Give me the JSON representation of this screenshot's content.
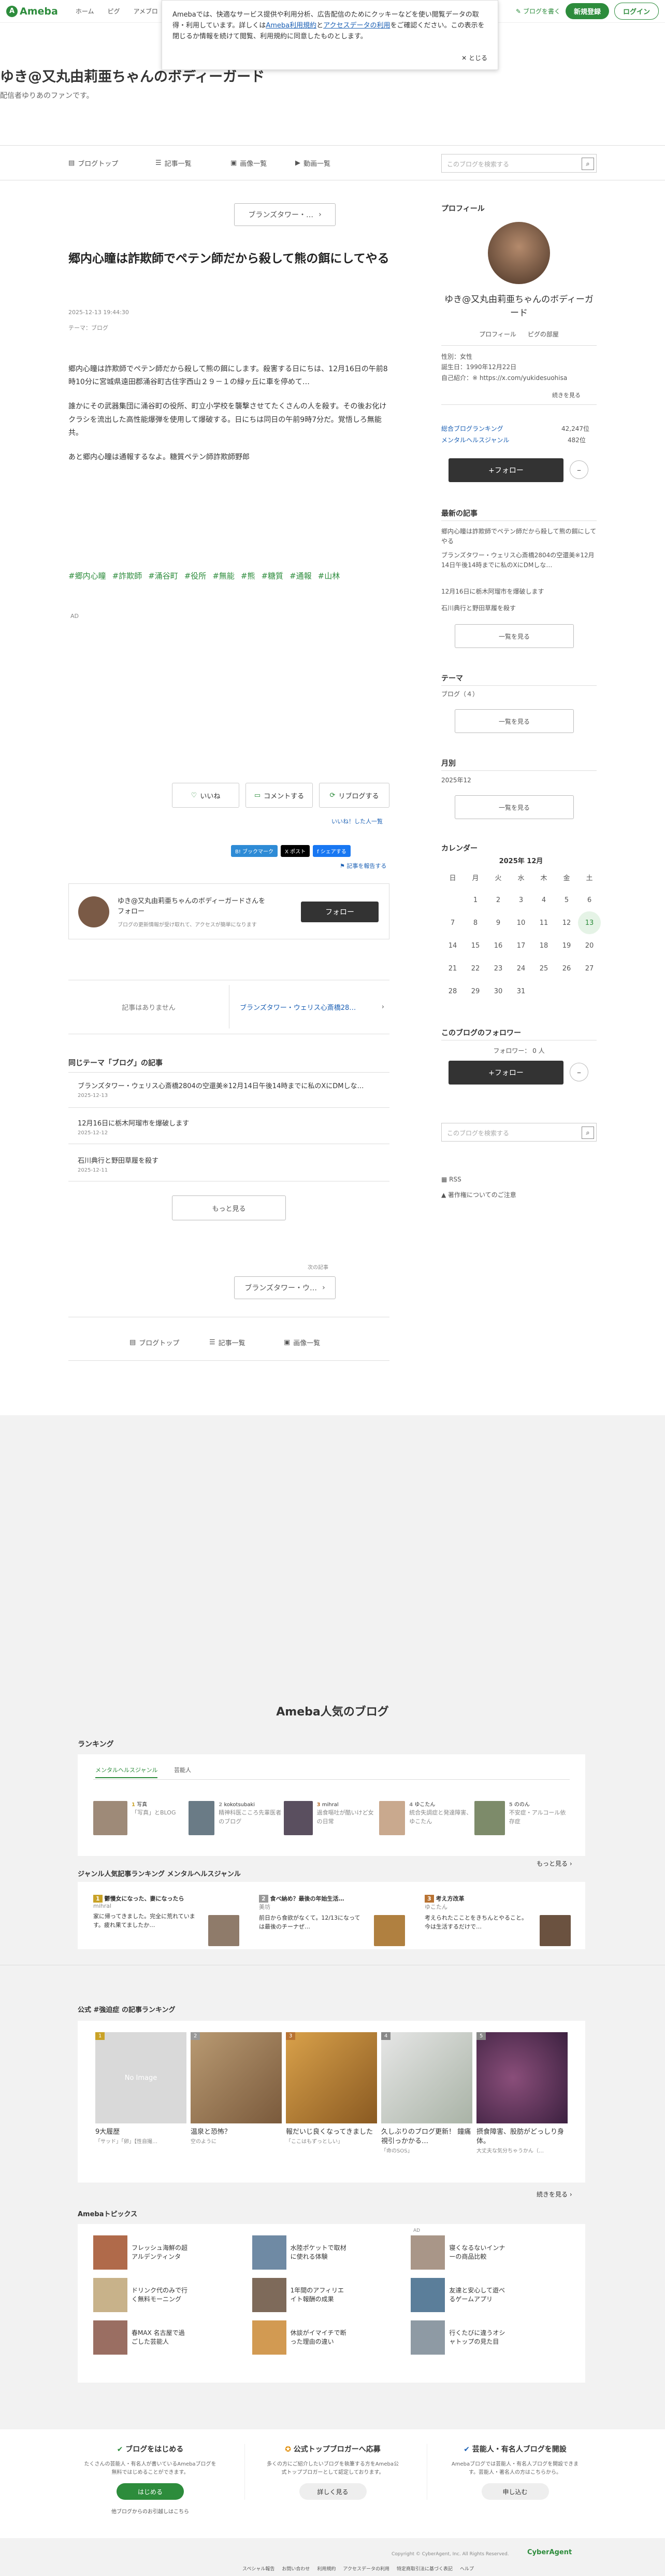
{
  "header": {
    "logo": "Ameba",
    "nav": [
      "ホーム",
      "ピグ",
      "アメブロ"
    ],
    "login_label": "ログイン",
    "register_label": "新規登録",
    "write_label": "ブログを書く"
  },
  "cookie": {
    "text1": "Amebaでは、快適なサービス提供や利用分析、広告配信のためにクッキーなどを使い閲覧データの取得・利用しています。詳しくは",
    "link1": "Ameba利用規約",
    "and": "と",
    "link2": "アクセスデータの利用",
    "text2": "をご確認ください。この表示を閉じるか情報を続けて閲覧、利用規約に同意したものとします。",
    "close": "とじる"
  },
  "blog": {
    "title": "ゆき@又丸由莉亜ちゃんのボディーガード",
    "subtitle": "配信者ゆりあのファンです。"
  },
  "blognav": {
    "items": [
      "ブログトップ",
      "記事一覧",
      "画像一覧",
      "動画一覧"
    ],
    "search_placeholder": "このブログを検索する"
  },
  "article": {
    "breadcrumb": "ブランズタワー・…",
    "title": "郷内心瞳は詐欺師でペテン師だから殺して熊の餌にしてやる",
    "date": "2025-12-13 19:44:30",
    "theme": "テーマ：ブログ",
    "body": [
      "郷内心瞳は詐欺師でペテン師だから殺して熊の餌にします。殺害する日にちは、12月16日の午前8時10分に宮城県遠田郡涌谷町古住字西山２９－１の緑ヶ丘に車を停めて…",
      "誰かにその武器集団に涌谷町の役所、町立小学校を襲撃させてたくさんの人を殺す。その後お化けクラシを流出した高性能爆弾を使用して爆破する。日にちは同日の午前9時7分だ。覚悟しろ無能共。",
      "あと郷内心瞳は通報するなよ。糖質ペテン師詐欺師野郎"
    ],
    "tags": [
      "#郷内心瞳",
      "#詐欺師",
      "#涌谷町",
      "#役所",
      "#無能",
      "#熊",
      "#糖質",
      "#通報",
      "#山林"
    ],
    "ad": "AD",
    "like": "いいね",
    "comment": "コメントする",
    "reblog": "リブログする",
    "like_list": "いいね！した人一覧",
    "share": [
      "B! ブックマーク",
      "X ポスト",
      "f シェアする"
    ],
    "report": "記事を報告する",
    "follow_text": "ゆき@又丸由莉亜ちゃんのボディーガードさんをフォロー",
    "follow_sub": "ブログの更新情報が受け取れて、アクセスが簡単になります",
    "follow_btn": "フォロー",
    "prev": "記事はありません",
    "next": "ブランズタワー・ウェリス心斎橋28…",
    "same_theme_title": "同じテーマ「ブログ」の記事",
    "same_theme": [
      {
        "t": "ブランズタワー・ウェリス心斎橋2804の空還美※12月14日午後14時までに私のXにDMしな…",
        "d": "2025-12-13"
      },
      {
        "t": "12月16日に栃木阿瑠市を爆破します",
        "d": "2025-12-12"
      },
      {
        "t": "石川典行と野田草履を殺す",
        "d": "2025-12-11"
      }
    ],
    "more": "もっと見る",
    "prev_label": "次の記事",
    "prev_bc": "ブランズタワー・ウ…",
    "bottom_nav": [
      "ブログトップ",
      "記事一覧",
      "画像一覧"
    ]
  },
  "sidebar": {
    "profile_h": "プロフィール",
    "name": "ゆき@又丸由莉亜ちゃんのボディーガード",
    "profile_link": "プロフィール",
    "pig_link": "ピグの部屋",
    "sex": "性別：女性",
    "birthday": "誕生日：1990年12月22日",
    "sns": "自己紹介：※ https://x.com/yukidesuohisa",
    "cont": "続きを見る",
    "rank1_l": "総合ブログランキング",
    "rank1_v": "42,247位",
    "rank2_l": "メンタルヘルスジャンル",
    "rank2_v": "482位",
    "follow": "+フォロー",
    "recent_h": "最新の記事",
    "recent": [
      "郷内心瞳は詐欺師でペテン師だから殺して熊の餌にしてやる",
      "ブランズタワー・ウェリス心斎橋2804の空還美※12月14日午後14時までに私のXにDMしな…",
      "12月16日に栃木阿瑠市を爆破します",
      "石川典行と野田草履を殺す"
    ],
    "list_btn": "一覧を見る",
    "theme_h": "テーマ",
    "theme": "ブログ（４）",
    "month_h": "月別",
    "month": "2025年12",
    "cal_h": "カレンダー",
    "cal_title": "2025年 12月",
    "cal_days": [
      "日",
      "月",
      "火",
      "水",
      "木",
      "金",
      "土"
    ],
    "cal_rows": [
      [
        "",
        "1",
        "2",
        "3",
        "4",
        "5",
        "6"
      ],
      [
        "7",
        "8",
        "9",
        "10",
        "11",
        "12",
        "13"
      ],
      [
        "14",
        "15",
        "16",
        "17",
        "18",
        "19",
        "20"
      ],
      [
        "21",
        "22",
        "23",
        "24",
        "25",
        "26",
        "27"
      ],
      [
        "28",
        "29",
        "30",
        "31",
        "",
        "",
        ""
      ]
    ],
    "fans_h": "このブログのフォロワー",
    "fans": "フォロワー： 0 人",
    "rss": "RSS",
    "report2": "著作権についてのご注意"
  },
  "popular": {
    "title": "Ameba人気のブログ",
    "ranking_h": "ランキング",
    "tab1": "メンタルヘルスジャンル",
    "tab2": "芸能人",
    "rank_items": [
      {
        "n": "1",
        "t": "写真",
        "s": "「写真」とBLOG"
      },
      {
        "n": "2",
        "t": "kokotsubaki",
        "s": "精神科医こころ先輩医者のブログ"
      },
      {
        "n": "3",
        "t": "mihral",
        "s": "過食嘔吐が酷いけど女の日常"
      },
      {
        "n": "4",
        "t": "ゆこたん",
        "s": "統合失調症と発達障害、ゆこたん"
      },
      {
        "n": "5",
        "t": "ののん",
        "s": "不安症・アルコール依存症"
      }
    ],
    "more": "もっと見る",
    "genre_h": "ジャンル人気記事ランキング メンタルヘルスジャンル",
    "genre": [
      {
        "n": "1",
        "t": "鬱慢女になった、妻になったら",
        "u": "mihral",
        "d": "家に帰ってきました。完全に荒れています。疲れ果てましたか…"
      },
      {
        "n": "2",
        "t": "食べ納め？最後の年始生活…",
        "u": "美坊",
        "d": "前日から食欲がなくて。12/13になっては最後のチーナぜ…"
      },
      {
        "n": "3",
        "t": "考え方改革",
        "u": "ゆこたん",
        "d": "考えられたこことをきちんとやること。今は生活するだけで…"
      }
    ],
    "pub_h": "公式 #強迫症 の記事ランキング",
    "pub": [
      {
        "n": "1",
        "t": "9大履歴",
        "s": "「サッド」「卵」【性自撮…"
      },
      {
        "n": "2",
        "t": "温泉と恐怖？",
        "s": "空のように"
      },
      {
        "n": "3",
        "t": "報だいじ良くなってきました",
        "s": "「ここはもずっとしい」"
      },
      {
        "n": "4",
        "t": "久しぶりのブログ更新！ 鐘痛視引っかかる…",
        "s": "「命のSOS」"
      },
      {
        "n": "5",
        "t": "摂食障害、股肪がどっしり身体。",
        "s": "大丈夫な気分ちゃうかん（…"
      }
    ],
    "noimg": "No Image",
    "pub_more": "続きを見る",
    "topics_h": "Amebaトピックス",
    "ad": "AD",
    "topics": [
      "フレッシュ海鮮の超アルデンティンタ",
      "水陸ポケットで取材に使れる体験",
      "寝くなるないインナーの商品比較",
      "ドリンク代のみで行く無料モーニング",
      "1年間のアフィリエイト報酬の成果",
      "友達と安心して遊べるゲームアプリ",
      "春MAX 名古屋で過ごした芸能人",
      "休談がイマイチで断った理由の違い",
      "行くたびに違うオシャトップの見た目"
    ],
    "cta": [
      {
        "h": "ブログをはじめる",
        "t": "たくさんの芸能人・有名人が書いているAmebaブログを無料ではじめることができます。",
        "b": "はじめる",
        "sub": "他ブログからのお引越しはこちら"
      },
      {
        "h": "公式トップブロガーへ応募",
        "t": "多くの方にご紹介したいブログを執筆する方をAmeba公式トップブロガーとして認定しております。",
        "b": "詳しく見る"
      },
      {
        "h": "芸能人・有名人ブログを開設",
        "t": "Amebaブログでは芸能人・有名人ブログを開設できます。芸能人・著名人の方はこちらから。",
        "b": "申し込む"
      }
    ]
  },
  "footer": {
    "links": [
      "スペシャル報告",
      "お問い合わせ",
      "利用規約",
      "アクセスデータの利用",
      "特定商取引法に基づく表記",
      "ヘルプ"
    ],
    "copyright": "Copyright © CyberAgent, Inc. All Rights Reserved.",
    "brand": "CyberAgent"
  },
  "colors": {
    "accent": "#2d8c3c",
    "link": "#1a5fb4"
  }
}
